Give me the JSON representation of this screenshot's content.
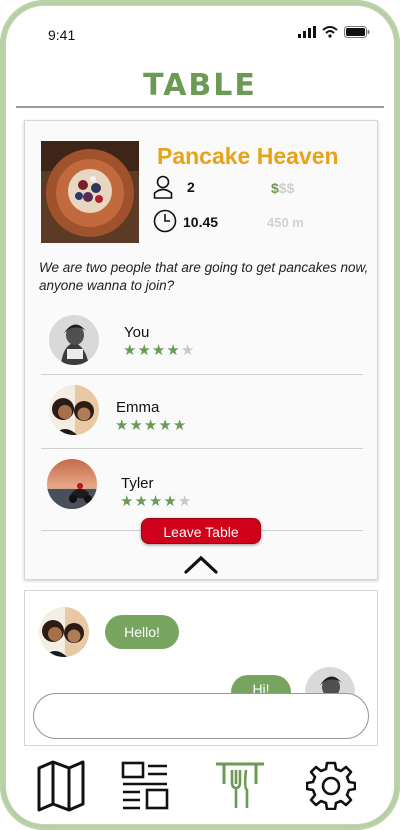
{
  "status_bar": {
    "time": "9:41"
  },
  "app": {
    "title": "TABLE"
  },
  "table": {
    "place_name": "Pancake Heaven",
    "people_count": "2",
    "price": {
      "active": "$",
      "inactive": "$$",
      "level_of_3": 1
    },
    "time": "10.45",
    "distance": "450 m",
    "description": "We are two people that are going to get pancakes now, anyone wanna to join?",
    "members": [
      {
        "name": "You",
        "rating": 4,
        "max": 5
      },
      {
        "name": "Emma",
        "rating": 5,
        "max": 5
      },
      {
        "name": "Tyler",
        "rating": 4,
        "max": 5
      }
    ],
    "leave_label": "Leave Table"
  },
  "chat": {
    "messages": [
      {
        "from": "other",
        "text": "Hello!"
      },
      {
        "from": "me",
        "text": "Hi!"
      }
    ],
    "input_placeholder": ""
  },
  "nav": {
    "items": [
      {
        "name": "map",
        "icon": "map-icon"
      },
      {
        "name": "feed",
        "icon": "list-layout-icon"
      },
      {
        "name": "table",
        "icon": "fork-knife-icon",
        "active": true
      },
      {
        "name": "settings",
        "icon": "gear-icon"
      }
    ]
  },
  "colors": {
    "accent": "#6a9a54",
    "place": "#e8a21a",
    "danger": "#d0021b"
  }
}
